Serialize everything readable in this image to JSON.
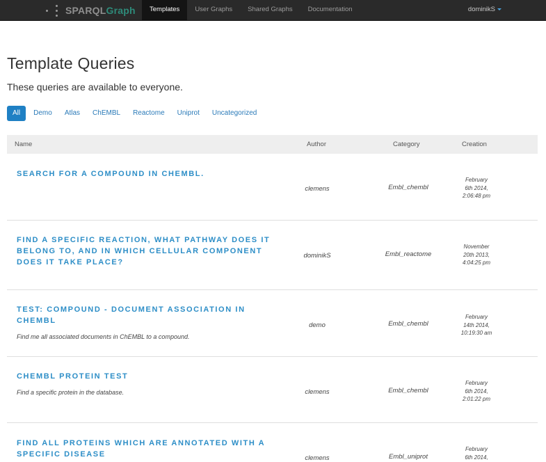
{
  "navbar": {
    "brand": {
      "part1": "SPARQL",
      "part2": "Graph"
    },
    "items": [
      {
        "label": "Templates",
        "active": true
      },
      {
        "label": "User Graphs",
        "active": false
      },
      {
        "label": "Shared Graphs",
        "active": false
      },
      {
        "label": "Documentation",
        "active": false
      }
    ],
    "user": "dominikS"
  },
  "page": {
    "title": "Template Queries",
    "subtitle": "These queries are available to everyone."
  },
  "filters": [
    {
      "label": "All",
      "active": true
    },
    {
      "label": "Demo",
      "active": false
    },
    {
      "label": "Atlas",
      "active": false
    },
    {
      "label": "ChEMBL",
      "active": false
    },
    {
      "label": "Reactome",
      "active": false
    },
    {
      "label": "Uniprot",
      "active": false
    },
    {
      "label": "Uncategorized",
      "active": false
    }
  ],
  "table": {
    "headers": {
      "name": "Name",
      "author": "Author",
      "category": "Category",
      "creation": "Creation"
    },
    "rows": [
      {
        "title": "Search for a compound in ChEMBL.",
        "description": "",
        "author": "clemens",
        "category": "Embl_chembl",
        "created": [
          "February",
          "6th 2014,",
          "2:06:48 pm"
        ]
      },
      {
        "title": "Find a specific reaction, what pathway does it belong to, and in which cellular component does it take place?",
        "description": "",
        "author": "dominikS",
        "category": "Embl_reactome",
        "created": [
          "November",
          "20th 2013,",
          "4:04:25 pm"
        ]
      },
      {
        "title": "Test: Compound - Document association in ChEMBL",
        "description": "Find me all associated documents in ChEMBL to a compound.",
        "author": "demo",
        "category": "Embl_chembl",
        "created": [
          "February",
          "14th 2014,",
          "10:19:30 am"
        ]
      },
      {
        "title": "ChEMBL protein test",
        "description": "Find a specific protein in the database.",
        "author": "clemens",
        "category": "Embl_chembl",
        "created": [
          "February",
          "6th 2014,",
          "2:01:22 pm"
        ]
      },
      {
        "title": "Find all proteins which are annotated with a specific disease",
        "description": "",
        "author": "clemens",
        "category": "Embl_uniprot",
        "created": [
          "February",
          "6th 2014,",
          ""
        ]
      }
    ]
  },
  "colors": {
    "navbar_bg": "#2a2a2a",
    "accent": "#1f80c4",
    "title_link": "#2d8ec7",
    "brand_graph": "#2e8b7a"
  }
}
